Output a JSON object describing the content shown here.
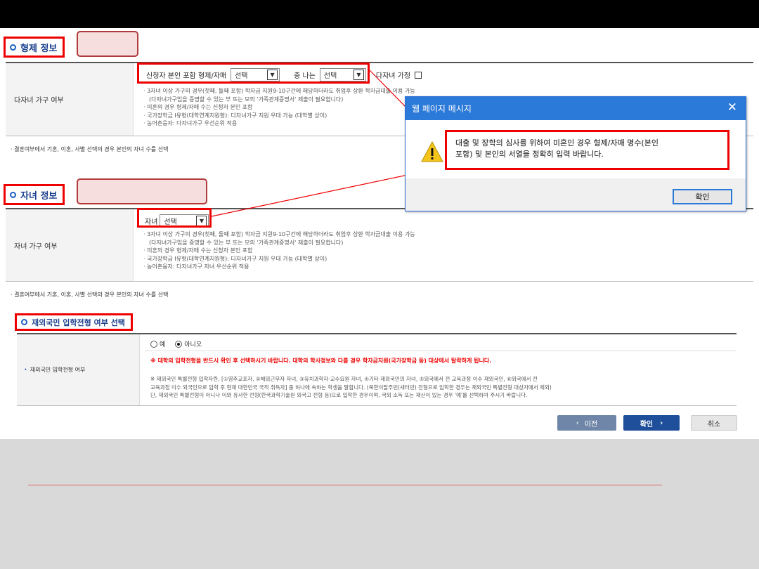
{
  "sibling_section": {
    "title": "형제 정보",
    "row_label": "다자녀 가구 여부",
    "field_label": "신청자 본인 포함 형제/자매",
    "select1_value": "선택",
    "middle_label": "중 나는",
    "select2_value": "선택",
    "multi_child_label": "다자녀 가정",
    "bullets": [
      "3자녀 이상 가구의 경우(첫째, 둘째 포함) 학자금 지원9-10구간에 해당하더라도 취업후 상환 학자금대출 이용 가능",
      "(다자녀가구임을 증명할 수 있는 부 또는 모의 '가족관계증명서' 제출이 필요합니다)",
      "미혼의 경우 형제/자매 수는 신청자 본인 포함",
      "국가장학금 I유형(대학연계지원형): 다자녀가구 지원 우대 가능 (대학별 상이)",
      "농어촌융자: 다자녀가구 우선순위 적용"
    ],
    "note": "결혼여부에서 기혼, 이혼, 사별 선택의 경우 본인의 자녀 수를 선택"
  },
  "child_section": {
    "title": "자녀 정보",
    "row_label": "자녀 가구 여부",
    "field_label": "자녀",
    "select_value": "선택",
    "bullets": [
      "3자녀 이상 가구의 경우(첫째, 둘째 포함) 학자금 지원9-10구간에 해당하더라도 취업후 상환 학자금대출 이용 가능",
      "(다자녀가구임을 증명할 수 있는 부 또는 모의 '가족관계증명서' 제출이 필요합니다)",
      "미혼의 경우 형제/자매 수는 신청자 본인 포함",
      "국가장학금 I유형(대학연계지원형): 다자녀가구 지원 우대 가능 (대학별 상이)",
      "농어촌융자: 다자녀가구 자녀 우선순위 적용"
    ],
    "note": "결혼여부에서 기혼, 이혼, 사별 선택의 경우 본인의 자녀 수를 선택"
  },
  "overseas_section": {
    "title": "재외국민 입학전형 여부 선택",
    "row_label": "재외국민 입학전형 여부",
    "radio_yes": "예",
    "radio_no": "아니오",
    "selected": "아니오",
    "warning": "※ 대학의 입학전형을 반드시 확인 후 선택하시기 바랍니다. 대학의 학사정보와 다를 경우 학자금지원(국가장학금 등) 대상에서 탈락하게 됩니다.",
    "desc_lines": [
      "※ 재외국민 특별전형 입학자란, [①영주교포자, ②해외근무자 자녀, ③유치과학자·교수요원 자녀, ④기타 재외국민의 자녀, ⑤외국에서 전 교육과정 이수 재외국민, ⑥외국에서 전",
      "교육과정 이수 외국인으로 입학 후 현재 대한민국 국적 취득자] 중 하나에 속하는 학생을 말합니다. (북한이탈주민(새터민) 전형으로 입학한 경우는 재외국민 특별전형 대상자에서 제외)",
      "단, 재외국민 특별전형이 아니나 이와 유사한 전형(한국과학기술원 외국고 전형 등)으로 입학한 경우이며, 국외 소득 또는 재산이 있는 경우 '예'를 선택하여 주시기 바랍니다."
    ]
  },
  "buttons": {
    "prev": "이전",
    "confirm": "확인",
    "cancel": "취소"
  },
  "dialog": {
    "title": "웹 페이지 메시지",
    "message_line1": "대출 및 장학의 심사를 위하여 미혼인 경우 형제/자매 명수(본인",
    "message_line2": "포함) 및 본인의 서열을 정확히 입력 바랍니다.",
    "ok_label": "확인"
  },
  "colors": {
    "highlight": "#e00000",
    "dialog_header": "#2b79d8",
    "primary_button": "#1f4e9a",
    "warning_text": "#e00000"
  }
}
